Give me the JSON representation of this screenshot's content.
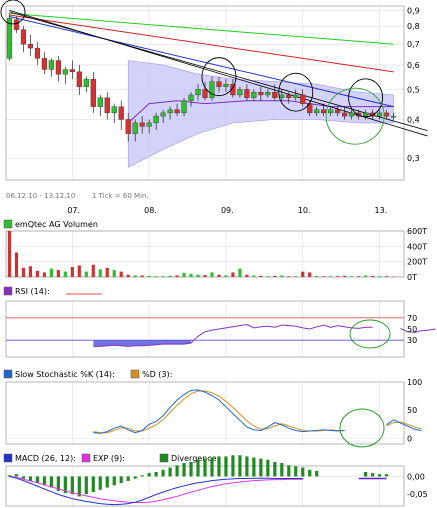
{
  "chart_data": [
    {
      "id": "price",
      "type": "candlestick",
      "period_text": "06.12.10 - 13.12.10",
      "interval_text": "1 Tick = 60 Min.",
      "y_ticks": [
        {
          "v": 0.9,
          "label": "0,9"
        },
        {
          "v": 0.8,
          "label": "0,8"
        },
        {
          "v": 0.7,
          "label": "0,7"
        },
        {
          "v": 0.6,
          "label": "0,6"
        },
        {
          "v": 0.5,
          "label": "0,5"
        },
        {
          "v": 0.4,
          "label": "0,4"
        },
        {
          "v": 0.3,
          "label": "0,3"
        }
      ],
      "y_scale": "log",
      "ylim": [
        0.255,
        0.93
      ],
      "x_ticks": [
        {
          "i": 9,
          "label": "07."
        },
        {
          "i": 20,
          "label": "08."
        },
        {
          "i": 31,
          "label": "09."
        },
        {
          "i": 42,
          "label": "10."
        },
        {
          "i": 53,
          "label": "13."
        }
      ],
      "candles": [
        [
          0.63,
          0.88,
          0.85,
          0.62
        ],
        [
          0.84,
          0.86,
          0.78,
          0.76
        ],
        [
          0.78,
          0.8,
          0.7,
          0.66
        ],
        [
          0.7,
          0.75,
          0.68,
          0.64
        ],
        [
          0.68,
          0.71,
          0.63,
          0.6
        ],
        [
          0.63,
          0.66,
          0.58,
          0.56
        ],
        [
          0.58,
          0.63,
          0.62,
          0.55
        ],
        [
          0.62,
          0.64,
          0.56,
          0.53
        ],
        [
          0.56,
          0.59,
          0.58,
          0.52
        ],
        [
          0.58,
          0.62,
          0.57,
          0.54
        ],
        [
          0.57,
          0.6,
          0.51,
          0.48
        ],
        [
          0.51,
          0.55,
          0.54,
          0.49
        ],
        [
          0.54,
          0.57,
          0.44,
          0.42
        ],
        [
          0.44,
          0.48,
          0.47,
          0.41
        ],
        [
          0.47,
          0.49,
          0.42,
          0.4
        ],
        [
          0.42,
          0.45,
          0.44,
          0.39
        ],
        [
          0.44,
          0.46,
          0.4,
          0.37
        ],
        [
          0.4,
          0.42,
          0.36,
          0.34
        ],
        [
          0.36,
          0.4,
          0.39,
          0.34
        ],
        [
          0.39,
          0.41,
          0.38,
          0.36
        ],
        [
          0.38,
          0.4,
          0.39,
          0.36
        ],
        [
          0.39,
          0.42,
          0.41,
          0.37
        ],
        [
          0.41,
          0.43,
          0.42,
          0.39
        ],
        [
          0.42,
          0.44,
          0.43,
          0.4
        ],
        [
          0.43,
          0.45,
          0.42,
          0.41
        ],
        [
          0.42,
          0.47,
          0.46,
          0.41
        ],
        [
          0.46,
          0.49,
          0.48,
          0.44
        ],
        [
          0.48,
          0.52,
          0.5,
          0.46
        ],
        [
          0.5,
          0.53,
          0.47,
          0.46
        ],
        [
          0.47,
          0.55,
          0.53,
          0.46
        ],
        [
          0.53,
          0.55,
          0.51,
          0.49
        ],
        [
          0.51,
          0.54,
          0.52,
          0.49
        ],
        [
          0.52,
          0.54,
          0.48,
          0.47
        ],
        [
          0.48,
          0.51,
          0.5,
          0.47
        ],
        [
          0.5,
          0.52,
          0.47,
          0.46
        ],
        [
          0.47,
          0.5,
          0.49,
          0.46
        ],
        [
          0.49,
          0.51,
          0.48,
          0.46
        ],
        [
          0.48,
          0.5,
          0.49,
          0.47
        ],
        [
          0.49,
          0.52,
          0.47,
          0.46
        ],
        [
          0.47,
          0.5,
          0.48,
          0.46
        ],
        [
          0.48,
          0.49,
          0.47,
          0.45
        ],
        [
          0.47,
          0.5,
          0.48,
          0.46
        ],
        [
          0.48,
          0.5,
          0.45,
          0.44
        ],
        [
          0.45,
          0.46,
          0.42,
          0.41
        ],
        [
          0.42,
          0.44,
          0.43,
          0.41
        ],
        [
          0.43,
          0.45,
          0.42,
          0.41
        ],
        [
          0.42,
          0.44,
          0.43,
          0.41
        ],
        [
          0.43,
          0.44,
          0.42,
          0.41
        ],
        [
          0.42,
          0.44,
          0.41,
          0.4
        ],
        [
          0.41,
          0.43,
          0.42,
          0.4
        ],
        [
          0.42,
          0.43,
          0.41,
          0.4
        ],
        [
          0.41,
          0.43,
          0.42,
          0.4
        ],
        [
          0.42,
          0.43,
          0.41,
          0.4
        ],
        [
          0.41,
          0.43,
          0.42,
          0.4
        ],
        [
          0.42,
          0.43,
          0.41,
          0.4
        ],
        [
          0.41,
          0.42,
          0.41,
          0.4
        ]
      ],
      "moving_averages": [
        {
          "color": "#22cc22",
          "from": [
            0,
            0.88
          ],
          "to": [
            55,
            0.7
          ]
        },
        {
          "color": "#cc2222",
          "from": [
            0,
            0.87
          ],
          "to": [
            55,
            0.57
          ]
        },
        {
          "color": "#2233cc",
          "from": [
            0,
            0.86
          ],
          "to": [
            55,
            0.44
          ]
        }
      ],
      "trendlines": [
        {
          "from": [
            0,
            0.9
          ],
          "to": [
            57,
            0.37
          ]
        },
        {
          "from": [
            0,
            0.89
          ],
          "to": [
            57,
            0.385
          ]
        }
      ],
      "bollinger": [
        {
          "i": 17,
          "upper": 0.62,
          "lower": 0.28
        },
        {
          "i": 22,
          "upper": 0.6,
          "lower": 0.32
        },
        {
          "i": 27,
          "upper": 0.56,
          "lower": 0.36
        },
        {
          "i": 32,
          "upper": 0.54,
          "lower": 0.39
        },
        {
          "i": 38,
          "upper": 0.53,
          "lower": 0.4
        },
        {
          "i": 44,
          "upper": 0.52,
          "lower": 0.4
        },
        {
          "i": 50,
          "upper": 0.49,
          "lower": 0.39
        },
        {
          "i": 55,
          "upper": 0.48,
          "lower": 0.39
        }
      ],
      "mid_band": [
        {
          "i": 17,
          "v": 0.39
        },
        {
          "i": 20,
          "v": 0.45
        },
        {
          "i": 24,
          "v": 0.46
        },
        {
          "i": 28,
          "v": 0.45
        },
        {
          "i": 34,
          "v": 0.46
        },
        {
          "i": 40,
          "v": 0.46
        },
        {
          "i": 46,
          "v": 0.44
        },
        {
          "i": 52,
          "v": 0.44
        },
        {
          "i": 55,
          "v": 0.44
        }
      ],
      "circles": [
        {
          "color": "#000000",
          "i": 0.5,
          "v": 0.89
        },
        {
          "color": "#000000",
          "i": 30,
          "v": 0.55
        },
        {
          "color": "#000000",
          "i": 41,
          "v": 0.49
        },
        {
          "color": "#000000",
          "i": 51,
          "v": 0.47
        },
        {
          "color": "#2d9e2d",
          "i": 49.5,
          "v": 0.41
        }
      ]
    },
    {
      "id": "volume",
      "type": "bar",
      "title": "emQtec AG Volumen",
      "y_ticks": [
        {
          "v": 600,
          "label": "600T"
        },
        {
          "v": 400,
          "label": "400T"
        },
        {
          "v": 200,
          "label": "200T"
        },
        {
          "v": 0,
          "label": "0T"
        }
      ],
      "ylim": [
        0,
        600
      ],
      "values": [
        650,
        320,
        120,
        140,
        80,
        60,
        110,
        90,
        70,
        130,
        150,
        70,
        160,
        100,
        120,
        90,
        70,
        30,
        20,
        20,
        15,
        10,
        10,
        15,
        20,
        55,
        40,
        30,
        25,
        60,
        30,
        20,
        60,
        110,
        30,
        20,
        15,
        10,
        15,
        20,
        10,
        10,
        70,
        60,
        15,
        10,
        10,
        10,
        15,
        10,
        10,
        20,
        15,
        10,
        10,
        5
      ],
      "down_flags": [
        1,
        1,
        1,
        1,
        1,
        1,
        0,
        1,
        0,
        1,
        1,
        0,
        1,
        0,
        1,
        0,
        1,
        1,
        0,
        1,
        0,
        0,
        0,
        0,
        1,
        0,
        0,
        0,
        1,
        0,
        1,
        0,
        1,
        0,
        1,
        0,
        1,
        0,
        1,
        0,
        1,
        0,
        1,
        1,
        0,
        1,
        0,
        1,
        1,
        0,
        1,
        0,
        1,
        0,
        1,
        1
      ]
    },
    {
      "id": "rsi",
      "type": "line",
      "title": "RSI (14):",
      "y_ticks": [
        {
          "v": 70,
          "label": "70"
        },
        {
          "v": 50,
          "label": "50"
        },
        {
          "v": 30,
          "label": "30"
        }
      ],
      "ylim": [
        0,
        100
      ],
      "start_index": 12,
      "values": [
        19,
        19,
        20,
        21,
        20,
        19,
        20,
        20,
        21,
        22,
        23,
        23,
        23,
        23,
        25,
        37,
        45,
        48,
        50,
        52,
        54,
        56,
        58,
        52,
        54,
        55,
        53,
        57,
        56,
        55,
        52,
        50,
        54,
        57,
        53,
        56,
        54,
        52,
        51,
        53,
        53,
        null,
        null,
        null,
        51,
        45,
        44,
        47,
        48,
        50,
        null
      ]
    },
    {
      "id": "stochastic",
      "type": "line",
      "title_k": "Slow Stochastic %K (14):",
      "title_d": "%D (3):",
      "y_ticks": [
        {
          "v": 100,
          "label": "100"
        },
        {
          "v": 50,
          "label": "50"
        },
        {
          "v": 0,
          "label": "0"
        }
      ],
      "ylim": [
        -10,
        100
      ],
      "k_series": {
        "start": 12,
        "values": [
          10,
          9,
          12,
          18,
          22,
          15,
          10,
          14,
          25,
          30,
          40,
          55,
          68,
          78,
          85,
          86,
          82,
          76,
          68,
          56,
          44,
          32,
          20,
          15,
          14,
          20,
          28,
          24,
          18,
          14,
          12,
          13,
          14,
          15,
          14,
          13,
          14,
          null,
          null,
          null,
          null,
          null,
          24,
          33,
          27,
          22,
          16,
          14
        ]
      },
      "d_series": {
        "start": 12,
        "values": [
          12,
          10,
          10,
          14,
          19,
          18,
          13,
          13,
          18,
          24,
          33,
          46,
          59,
          70,
          79,
          84,
          84,
          81,
          75,
          66,
          55,
          43,
          31,
          22,
          16,
          17,
          22,
          26,
          22,
          18,
          14,
          13,
          13,
          14,
          15,
          14,
          14,
          null,
          null,
          null,
          null,
          null,
          22,
          28,
          29,
          25,
          20,
          17
        ]
      }
    },
    {
      "id": "macd",
      "type": "bar",
      "title_macd": "MACD (26, 12):",
      "title_exp": "EXP (9):",
      "title_div": "Divergence:",
      "y_ticks": [
        {
          "v": 0.0,
          "label": "0,00"
        },
        {
          "v": -0.05,
          "label": "-0,05"
        }
      ],
      "ylim": [
        -0.085,
        0.03
      ],
      "divergence": [
        0.001,
        0.002,
        -0.002,
        -0.004,
        -0.006,
        -0.008,
        -0.01,
        -0.013,
        -0.015,
        -0.016,
        -0.018,
        -0.016,
        -0.014,
        -0.012,
        -0.01,
        -0.008,
        -0.006,
        -0.004,
        -0.002,
        0.001,
        0.003,
        0.004,
        0.006,
        0.008,
        0.01,
        0.012,
        0.013,
        0.015,
        0.016,
        0.017,
        0.018,
        0.018,
        0.019,
        0.019,
        0.018,
        0.017,
        0.016,
        0.015,
        0.013,
        0.012,
        0.01,
        0.009,
        0.008,
        0.006,
        0.005,
        null,
        null,
        null,
        null,
        null,
        null,
        0.004,
        0.003,
        0.002,
        0.002
      ],
      "macd_line": [
        0.0,
        -0.005,
        -0.012,
        -0.02,
        -0.028,
        -0.036,
        -0.044,
        -0.052,
        -0.058,
        -0.064,
        -0.068,
        -0.072,
        -0.075,
        -0.078,
        -0.08,
        -0.081,
        -0.08,
        -0.078,
        -0.074,
        -0.068,
        -0.06,
        -0.052,
        -0.045,
        -0.038,
        -0.032,
        -0.027,
        -0.022,
        -0.018,
        -0.015,
        -0.012,
        -0.01,
        -0.008,
        -0.007,
        -0.006,
        -0.006,
        -0.005,
        -0.005,
        -0.005,
        -0.006,
        -0.006,
        -0.006,
        -0.006,
        -0.006,
        null,
        null,
        null,
        null,
        null,
        null,
        null,
        -0.005,
        -0.005,
        -0.005,
        -0.005,
        -0.005
      ],
      "exp_line": [
        0.0,
        -0.003,
        -0.008,
        -0.013,
        -0.018,
        -0.024,
        -0.03,
        -0.036,
        -0.042,
        -0.047,
        -0.052,
        -0.056,
        -0.06,
        -0.064,
        -0.067,
        -0.07,
        -0.072,
        -0.074,
        -0.075,
        -0.075,
        -0.074,
        -0.071,
        -0.067,
        -0.062,
        -0.057,
        -0.051,
        -0.045,
        -0.04,
        -0.034,
        -0.029,
        -0.025,
        -0.021,
        -0.018,
        -0.016,
        -0.014,
        -0.012,
        -0.011,
        -0.01,
        -0.009,
        -0.009,
        -0.008,
        -0.008,
        -0.008,
        null,
        null,
        null,
        null,
        null,
        null,
        null,
        -0.007,
        -0.007,
        -0.007,
        -0.007,
        -0.007
      ]
    }
  ],
  "colors": {
    "up": "#2ebf2e",
    "down": "#d83030",
    "band": "#c8c8f8",
    "bandEdge": "#9898e8",
    "mid": "#7a2fc0",
    "rsi": "#8a2fc0",
    "rsiFill": "#5a5ae0",
    "k": "#2266cc",
    "d": "#d69020",
    "macd": "#2233cc",
    "exp": "#dd33dd",
    "div": "#1f8a1f",
    "volUp": "#33bb33",
    "volDown": "#cc3333",
    "grid": "#dddddd",
    "frame": "#888888",
    "h70": "#e05050",
    "h30": "#5050e0"
  }
}
